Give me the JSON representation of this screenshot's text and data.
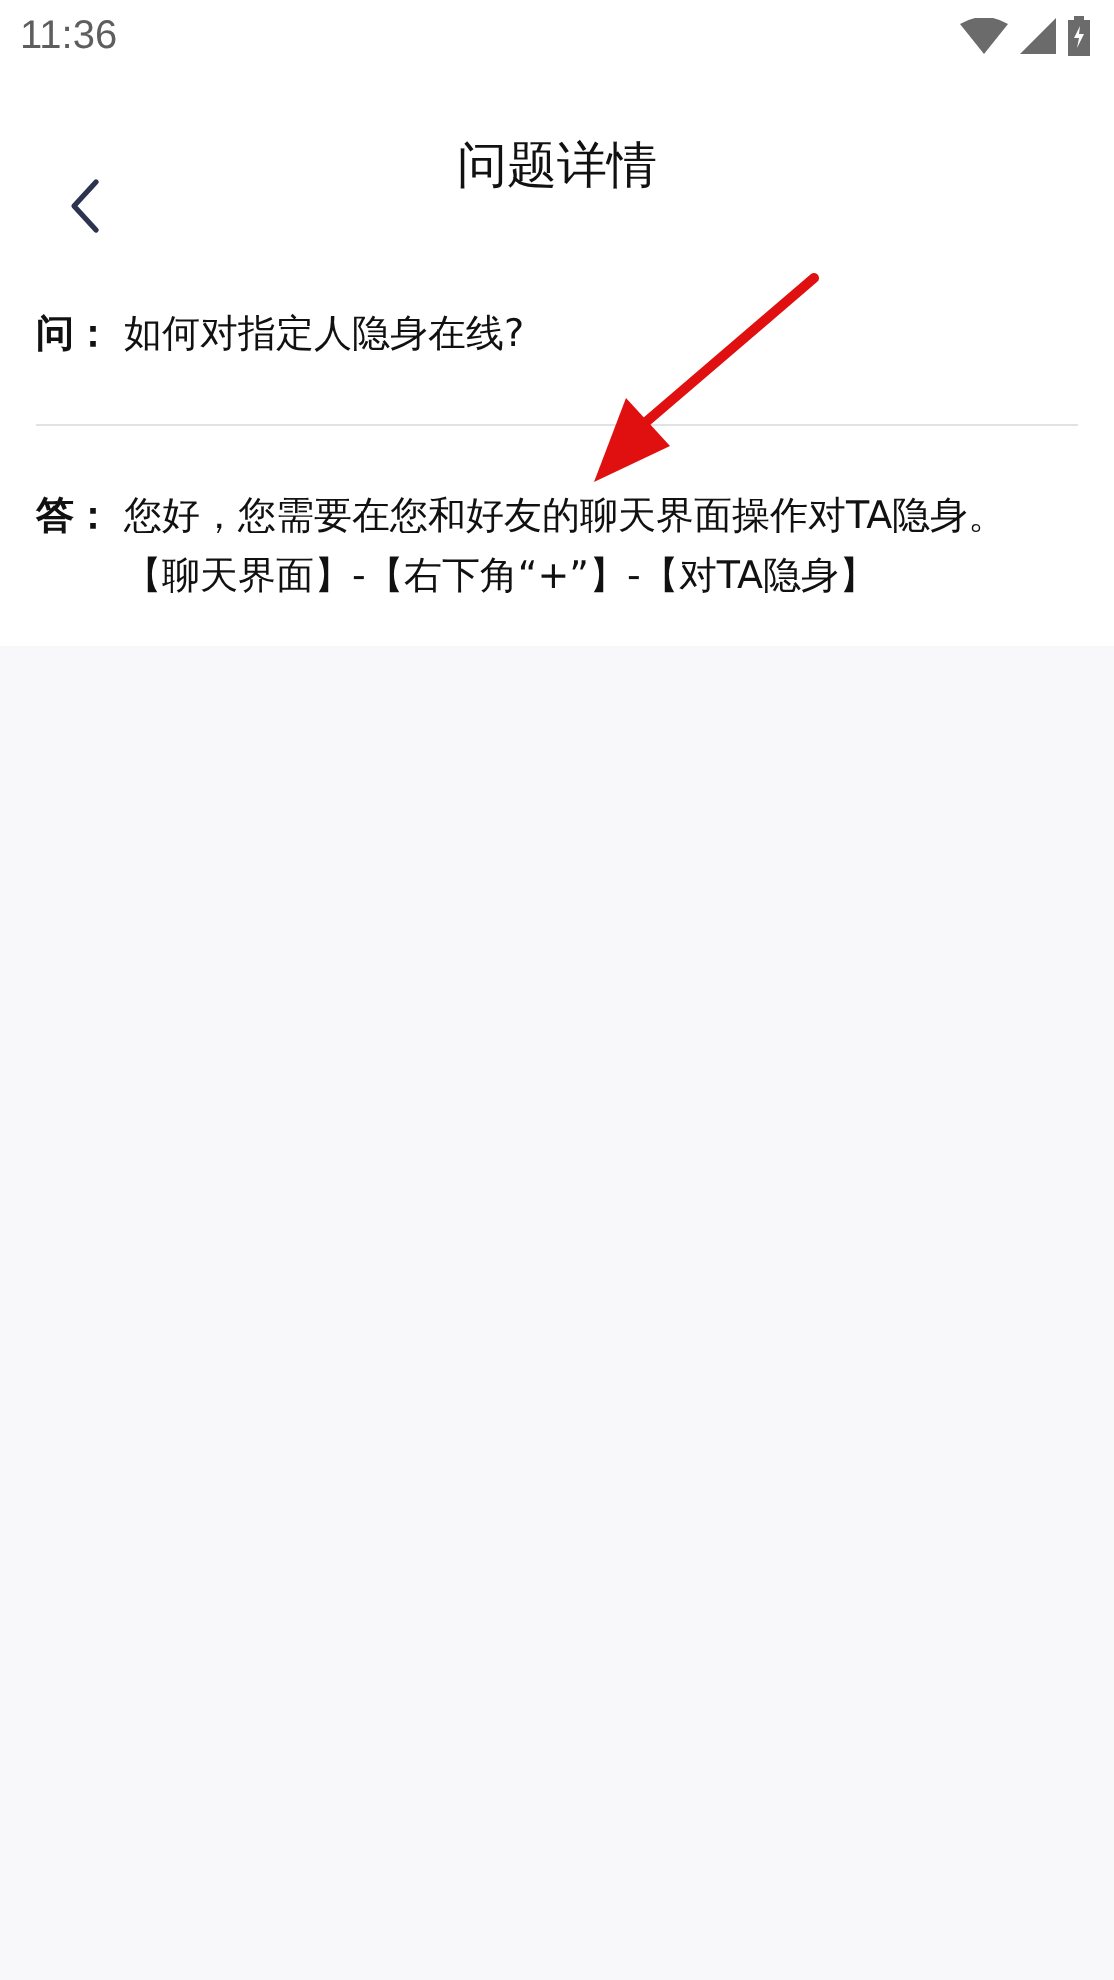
{
  "status_bar": {
    "time": "11:36"
  },
  "header": {
    "title": "问题详情"
  },
  "question": {
    "label": "问：",
    "text": "如何对指定人隐身在线?"
  },
  "answer": {
    "label": "答：",
    "text": "您好，您需要在您和好友的聊天界面操作对TA隐身。【聊天界面】-【右下角“+”】-【对TA隐身】"
  }
}
